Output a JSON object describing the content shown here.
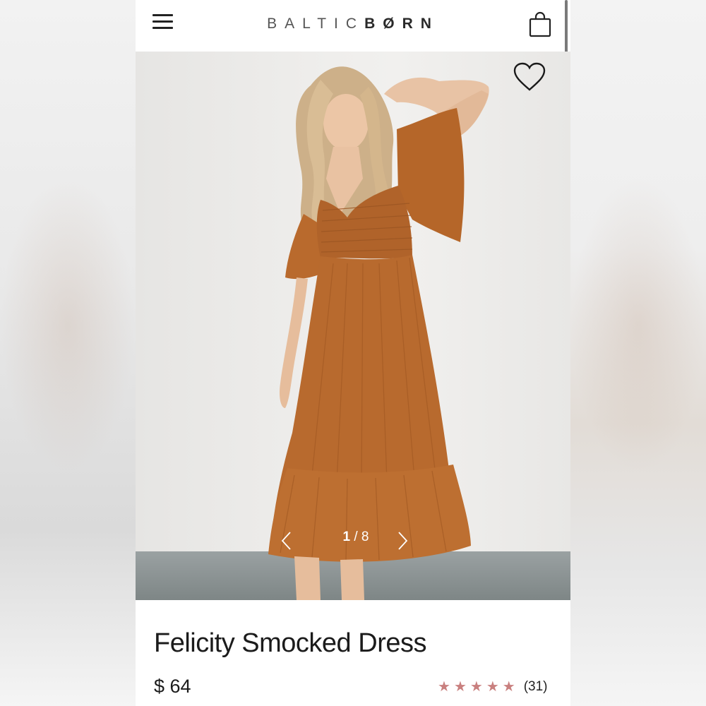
{
  "header": {
    "brand_left": "BALTIC",
    "brand_right": "BØRN",
    "menu_icon": "hamburger-menu-icon",
    "bag_icon": "shopping-bag-icon"
  },
  "gallery": {
    "current": "1",
    "separator": "/",
    "total": "8",
    "favorite_icon": "heart-icon",
    "prev_icon": "chevron-left-icon",
    "next_icon": "chevron-right-icon"
  },
  "product": {
    "name": "Felicity Smocked Dress",
    "price": "$ 64",
    "rating_value": 5,
    "rating_max": 5,
    "review_count": "(31)"
  },
  "colors": {
    "dress": "#b86a2e",
    "star": "#c9807f",
    "text": "#1b1b1b"
  }
}
